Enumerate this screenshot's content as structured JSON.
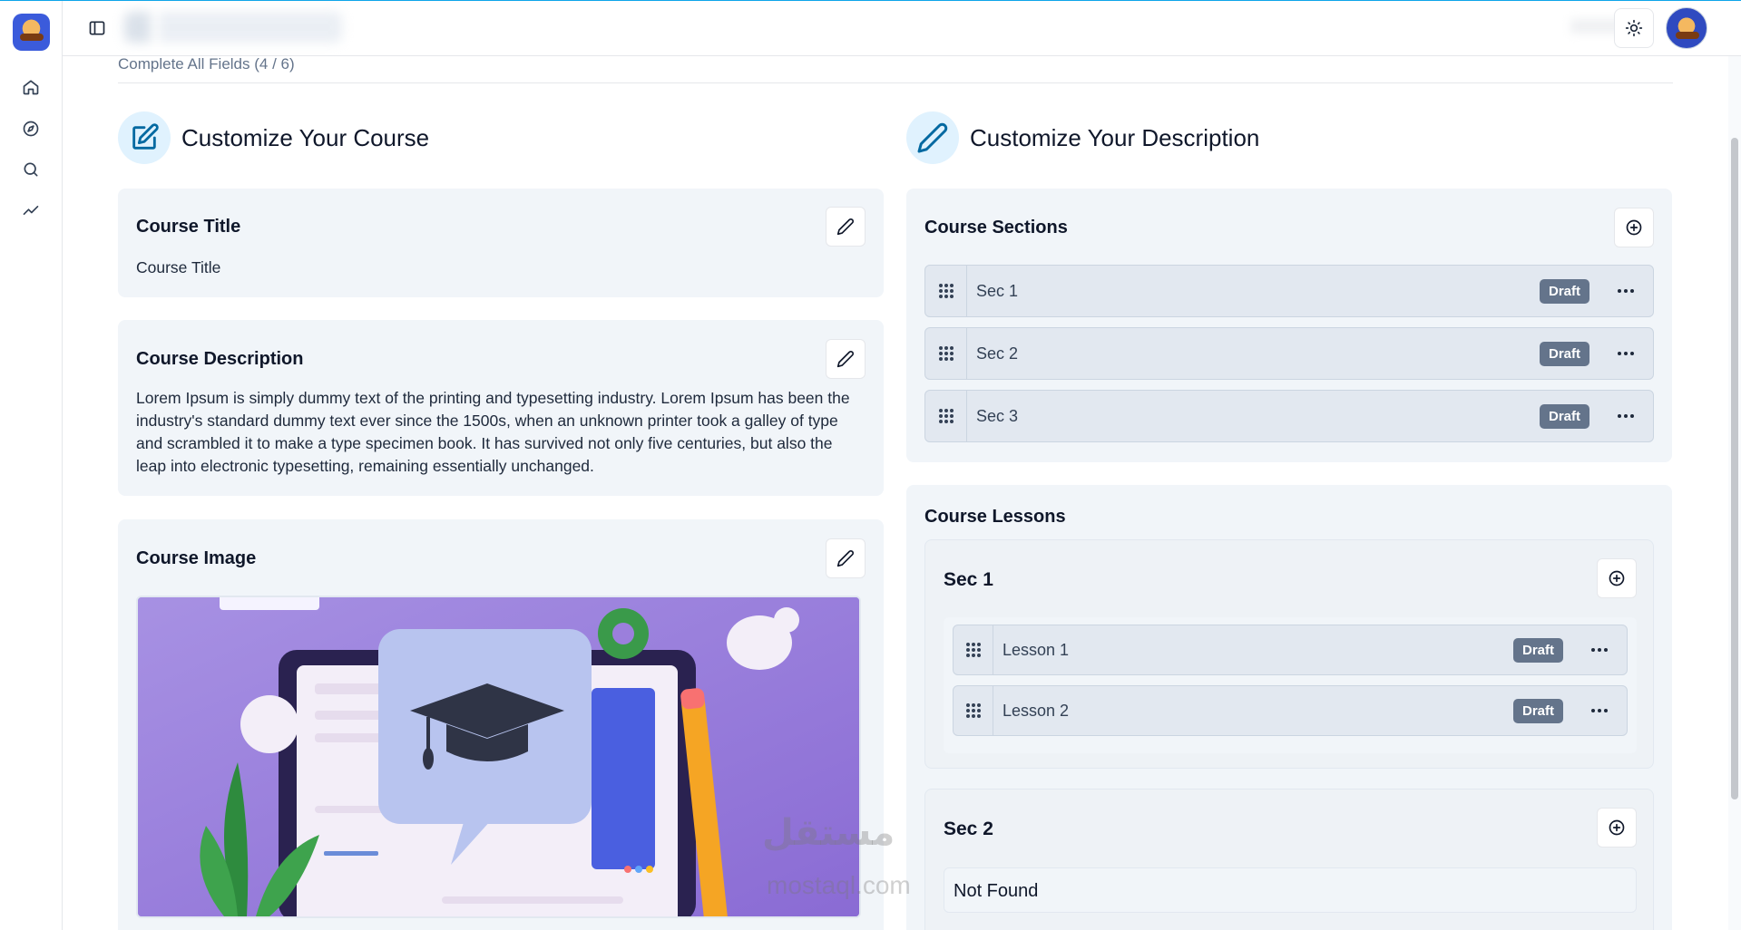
{
  "progress": {
    "text": "Complete All Fields (4 / 6)"
  },
  "left_section": {
    "title": "Customize Your Course"
  },
  "right_section": {
    "title": "Customize Your Description"
  },
  "course_title": {
    "heading": "Course Title",
    "value": "Course Title"
  },
  "course_description": {
    "heading": "Course Description",
    "value": "Lorem Ipsum is simply dummy text of the printing and typesetting industry. Lorem Ipsum has been the industry's standard dummy text ever since the 1500s, when an unknown printer took a galley of type and scrambled it to make a type specimen book. It has survived not only five centuries, but also the leap into electronic typesetting, remaining essentially unchanged."
  },
  "course_image": {
    "heading": "Course Image"
  },
  "course_sections": {
    "heading": "Course Sections",
    "items": [
      {
        "label": "Sec 1",
        "status": "Draft"
      },
      {
        "label": "Sec 2",
        "status": "Draft"
      },
      {
        "label": "Sec 3",
        "status": "Draft"
      }
    ]
  },
  "course_lessons": {
    "heading": "Course Lessons",
    "groups": [
      {
        "title": "Sec 1",
        "lessons": [
          {
            "label": "Lesson 1",
            "status": "Draft"
          },
          {
            "label": "Lesson 2",
            "status": "Draft"
          }
        ]
      },
      {
        "title": "Sec 2",
        "empty_text": "Not Found"
      }
    ]
  },
  "watermark": {
    "arabic": "مستقل",
    "latin": "mostaql.com"
  },
  "icons": {
    "sidebar": [
      "home-icon",
      "compass-icon",
      "search-icon",
      "trending-icon"
    ],
    "topbar": [
      "panel-toggle-icon",
      "sun-icon"
    ]
  },
  "colors": {
    "accent": "#0369a1",
    "badge": "#64748b",
    "card_bg": "#f1f5f9"
  }
}
